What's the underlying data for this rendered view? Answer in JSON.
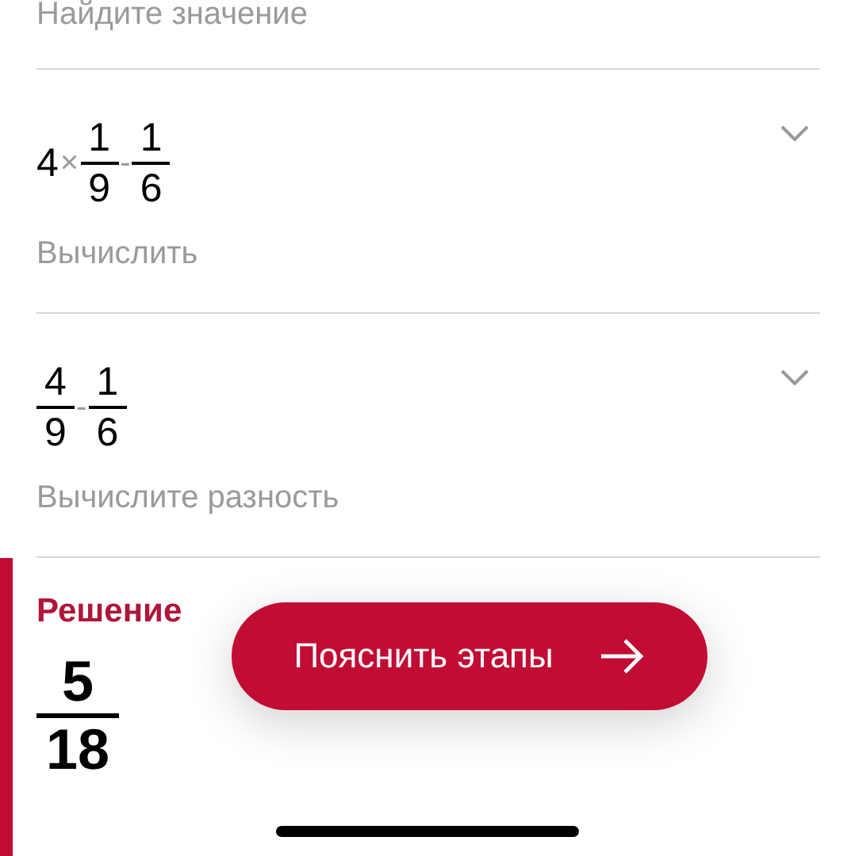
{
  "previous_step": {
    "label": "Найдите значение"
  },
  "steps": [
    {
      "expanded": false,
      "expression": [
        {
          "kind": "number",
          "text": "4"
        },
        {
          "kind": "operator",
          "text": "×"
        },
        {
          "kind": "fraction",
          "numerator": "1",
          "denominator": "9"
        },
        {
          "kind": "operator",
          "text": "-"
        },
        {
          "kind": "fraction",
          "numerator": "1",
          "denominator": "6"
        }
      ],
      "label": "Вычислить"
    },
    {
      "expanded": false,
      "expression": [
        {
          "kind": "fraction",
          "numerator": "4",
          "denominator": "9"
        },
        {
          "kind": "operator",
          "text": "-"
        },
        {
          "kind": "fraction",
          "numerator": "1",
          "denominator": "6"
        }
      ],
      "label": "Вычислите разность"
    }
  ],
  "solution": {
    "title": "Решение",
    "result": {
      "numerator": "5",
      "denominator": "18"
    }
  },
  "explain_button": {
    "label": "Пояснить этапы"
  }
}
